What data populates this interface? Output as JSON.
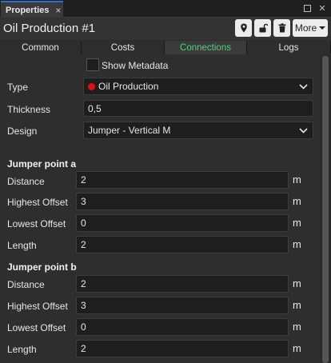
{
  "window": {
    "tab_title": "Properties",
    "close_glyph": "×"
  },
  "header": {
    "title": "Oil Production #1",
    "more_label": "More"
  },
  "tabs": [
    {
      "label": "Common",
      "active": false
    },
    {
      "label": "Costs",
      "active": false
    },
    {
      "label": "Connections",
      "active": true
    },
    {
      "label": "Logs",
      "active": false
    }
  ],
  "show_metadata": {
    "label": "Show Metadata",
    "checked": false
  },
  "properties": {
    "type": {
      "label": "Type",
      "value": "Oil Production",
      "color": "#e01010"
    },
    "thickness": {
      "label": "Thickness",
      "value": "0,5"
    },
    "design": {
      "label": "Design",
      "value": "Jumper - Vertical M"
    }
  },
  "jumper_a": {
    "title": "Jumper point a",
    "distance": {
      "label": "Distance",
      "value": "2",
      "unit": "m"
    },
    "highest_offset": {
      "label": "Highest Offset",
      "value": "3",
      "unit": "m"
    },
    "lowest_offset": {
      "label": "Lowest Offset",
      "value": "0",
      "unit": "m"
    },
    "length": {
      "label": "Length",
      "value": "2",
      "unit": "m"
    }
  },
  "jumper_b": {
    "title": "Jumper point b",
    "distance": {
      "label": "Distance",
      "value": "2",
      "unit": "m"
    },
    "highest_offset": {
      "label": "Highest Offset",
      "value": "3",
      "unit": "m"
    },
    "lowest_offset": {
      "label": "Lowest Offset",
      "value": "0",
      "unit": "m"
    },
    "length": {
      "label": "Length",
      "value": "2",
      "unit": "m"
    }
  },
  "icons": [
    "location-pin-icon",
    "unlock-icon",
    "trash-icon",
    "chevron-down-icon",
    "maximize-icon",
    "close-icon"
  ]
}
